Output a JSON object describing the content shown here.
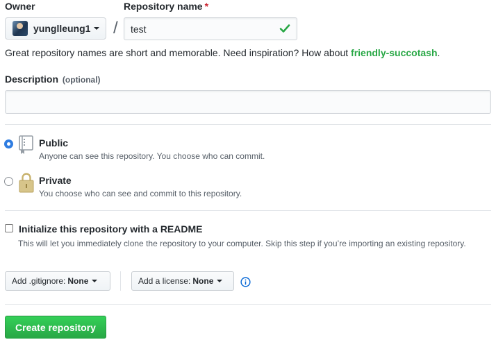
{
  "owner": {
    "label": "Owner",
    "selected": "yunglleung1",
    "avatar_icon": "user-avatar"
  },
  "repository_name": {
    "label": "Repository name",
    "required_mark": "*",
    "value": "test",
    "valid_icon": "check-icon"
  },
  "separator": "/",
  "hint": {
    "text": "Great repository names are short and memorable. Need inspiration? How about ",
    "suggestion": "friendly-succotash",
    "suffix": "."
  },
  "description": {
    "label": "Description",
    "optional": "(optional)",
    "value": "",
    "placeholder": ""
  },
  "visibility": {
    "selected": "public",
    "public": {
      "title": "Public",
      "note": "Anyone can see this repository. You choose who can commit.",
      "icon": "repo-book-icon"
    },
    "private": {
      "title": "Private",
      "note": "You choose who can see and commit to this repository.",
      "icon": "lock-icon"
    }
  },
  "readme": {
    "checked": false,
    "title": "Initialize this repository with a README",
    "note": "This will let you immediately clone the repository to your computer. Skip this step if you’re importing an existing repository."
  },
  "gitignore": {
    "prefix": "Add .gitignore:",
    "value": "None"
  },
  "license": {
    "prefix": "Add a license:",
    "value": "None",
    "info_icon": "info-icon"
  },
  "submit": {
    "label": "Create repository"
  },
  "colors": {
    "accent_green": "#28a745",
    "radio_blue": "#2f7de1",
    "required_red": "#cb2431",
    "info_blue": "#0366d6"
  }
}
